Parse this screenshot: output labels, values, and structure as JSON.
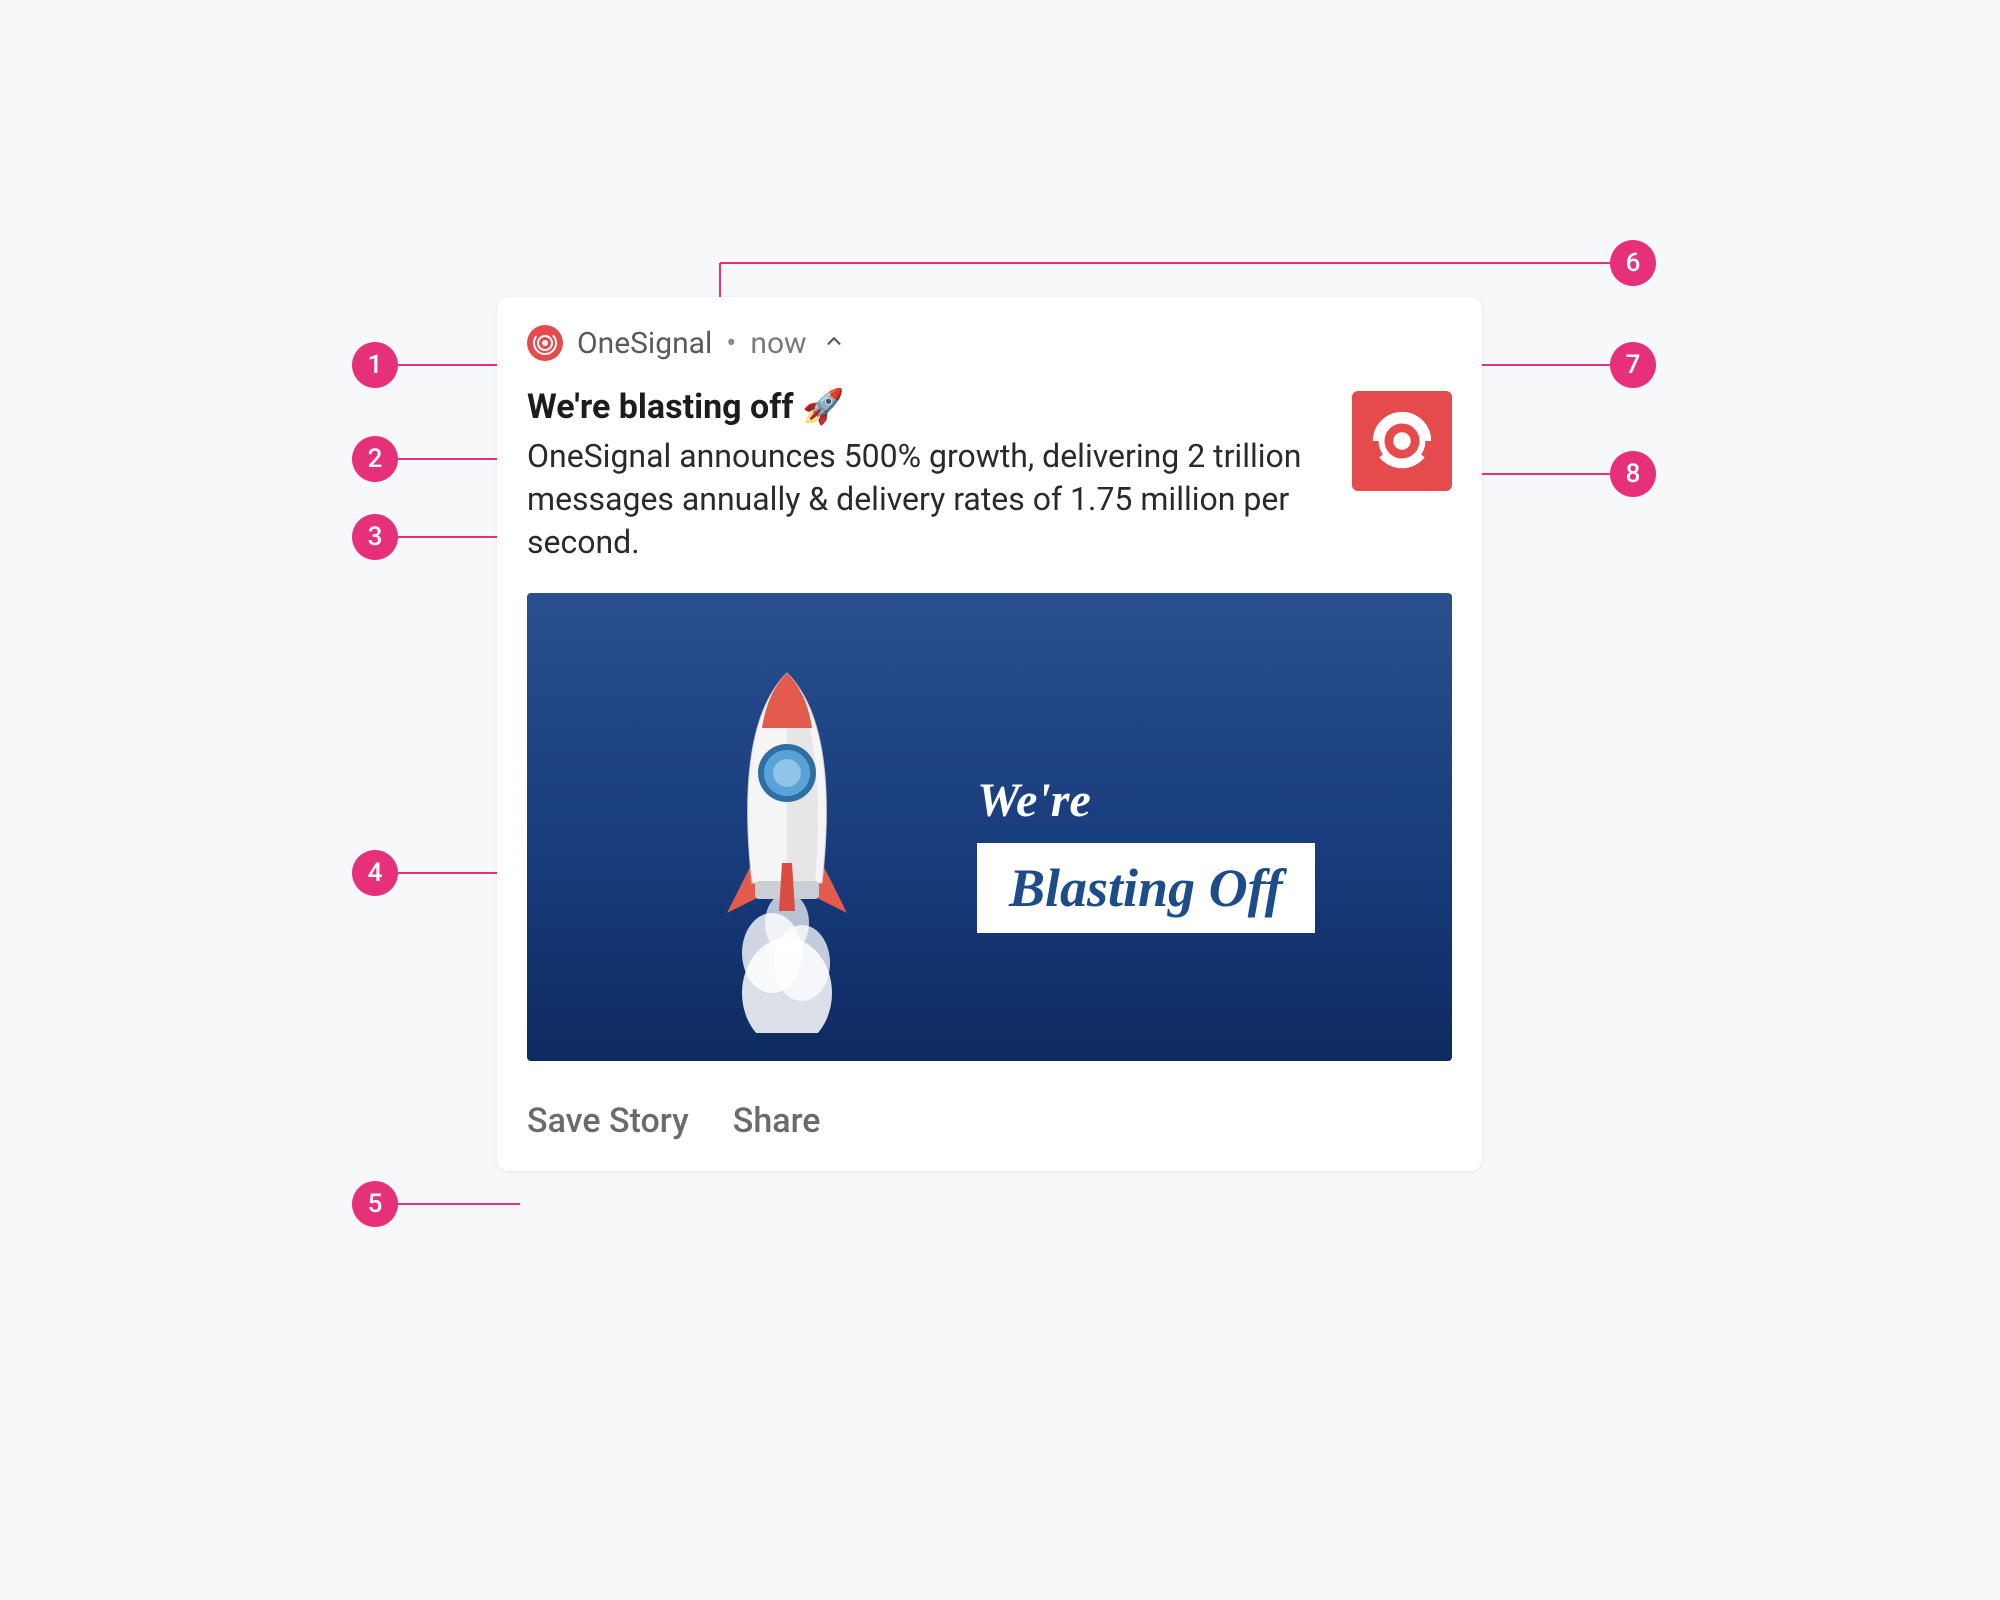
{
  "notification": {
    "app_name": "OneSignal",
    "separator": "•",
    "time": "now",
    "title": "We're blasting off 🚀",
    "message": "OneSignal announces 500% growth, delivering 2 trillion messages annually & delivery rates of 1.75 million per second.",
    "big_picture": {
      "line1": "We're",
      "line2": "Blasting Off"
    },
    "actions": {
      "save": "Save Story",
      "share": "Share"
    }
  },
  "callouts": {
    "c1": "1",
    "c2": "2",
    "c3": "3",
    "c4": "4",
    "c5": "5",
    "c6": "6",
    "c7": "7",
    "c8": "8"
  },
  "colors": {
    "accent": "#e6307a",
    "brand": "#e54b4d"
  }
}
